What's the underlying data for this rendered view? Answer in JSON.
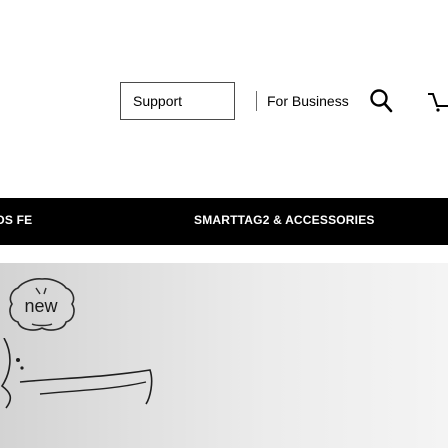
{
  "header": {
    "nav": {
      "support_label": "Support",
      "business_label": "For Business"
    },
    "icons": {
      "search": "search-icon",
      "cart": "cart-icon"
    }
  },
  "nav_bar": {
    "left_category": "DS FE",
    "right_category": "SMARTTAG2 & ACCESSORIES"
  },
  "hero": {
    "sticker_text": "new"
  },
  "colors": {
    "nav_bar_bg": "#000000",
    "nav_text": "#ffffff",
    "hero_bg_start": "#d3d3d3",
    "hero_bg_end": "#f4f4f4"
  }
}
